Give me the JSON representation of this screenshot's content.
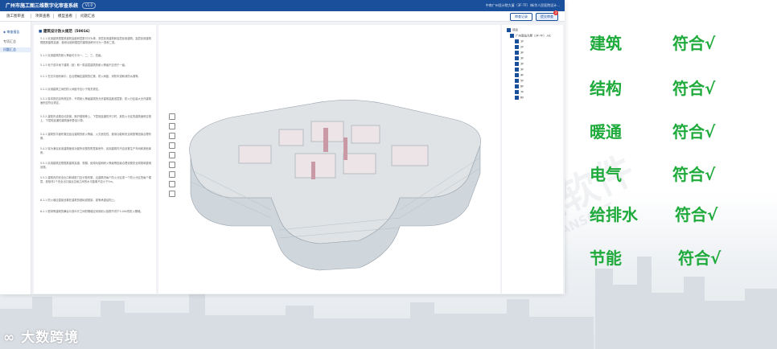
{
  "app": {
    "title": "广州市施工图三维数字化审查系统",
    "version_tag": "V1.0",
    "user_info": "中南广州设计院大厦（3F-7F）/新华人民医院设计...",
    "tabs": [
      "施工图审查",
      "项目查看",
      "模型查看",
      "问题汇总"
    ],
    "buttons": {
      "review_record": "审查记录",
      "submit_review": "提交审查"
    },
    "notification_count": "3"
  },
  "left_nav": {
    "header": "审查报告",
    "items": [
      "专项汇总",
      "问题汇总"
    ]
  },
  "text_pane": {
    "title": "建筑设计防火规范（50016）",
    "paragraphs": [
      "5.1.1 民用建筑根据其建筑高度和层数可分为单、多层民用建筑和高层民用建筑。高层民用建筑根据其建筑高度、使用功能和楼层的建筑面积可分为一类和二类。",
      "5.1.2 民用建筑的耐火等级可分为一、二、三、四级。",
      "5.1.3 地下或半地下建筑（室）和一类高层建筑的耐火等级不应低于一级。",
      "5.2.1 在总平面布局中，应合理确定建筑的位置、防火间距、消防车道和消防水源等。",
      "5.2.2 民用建筑之间的防火间距不应小于相关规定。",
      "5.3.1 除本规范另有规定外，不同耐火等级建筑的允许建筑高度或层数、防火分区最大允许建筑面积应符合规定。",
      "5.3.2 建筑内设置自动扶梯、敞开楼梯等上、下层相连通的开口时，其防火分区的建筑面积应按上、下层相连通的建筑面积叠加计算。",
      "5.4.1 建筑的平面布置应结合建筑的耐火等级、火灾危险性、使用功能和安全疏散等因素合理布置。",
      "5.4.2 除为满足民用建筑使用功能所设置的附属库房外，民用建筑内不应设置生产车间和其他库房。",
      "5.5.1 民用建筑应根据其建筑高度、规模、使用功能和耐火等级等因素合理设置安全疏散和避难设施。",
      "5.5.2 建筑内的安全出口和疏散门应分散布置，且建筑内每个防火分区或一个防火分区的每个楼层，其相邻2个安全出口最近边缘之间的水平距离不应小于5m。",
      "6.1.1 防火墙应直接设置在建筑的基础或框架、梁等承重结构上。",
      "6.2.1 剧场等建筑的舞台与观众厅之间的隔墙应采用耐火极限不低于3.00h的防火隔墙。"
    ]
  },
  "tree": {
    "root": "项目",
    "model": "广州南站大厦（3F-7F）.rvt",
    "levels": [
      "1F",
      "2F",
      "3F",
      "3F",
      "3F",
      "3F",
      "4F",
      "5F",
      "6F",
      "7F",
      "RF"
    ]
  },
  "checklist": [
    {
      "discipline": "建筑",
      "status": "符合√"
    },
    {
      "discipline": "结构",
      "status": "符合√"
    },
    {
      "discipline": "暖通",
      "status": "符合√"
    },
    {
      "discipline": "电气",
      "status": "符合√"
    },
    {
      "discipline": "给排水",
      "status": "符合√"
    },
    {
      "discipline": "节能",
      "status": "符合√"
    }
  ],
  "watermark": {
    "text": "鲁班软件",
    "sub": "LUBANSOFT"
  },
  "brand": "大数跨境",
  "colors": {
    "primary": "#1a4f9c",
    "check_green": "#1faa3c"
  }
}
